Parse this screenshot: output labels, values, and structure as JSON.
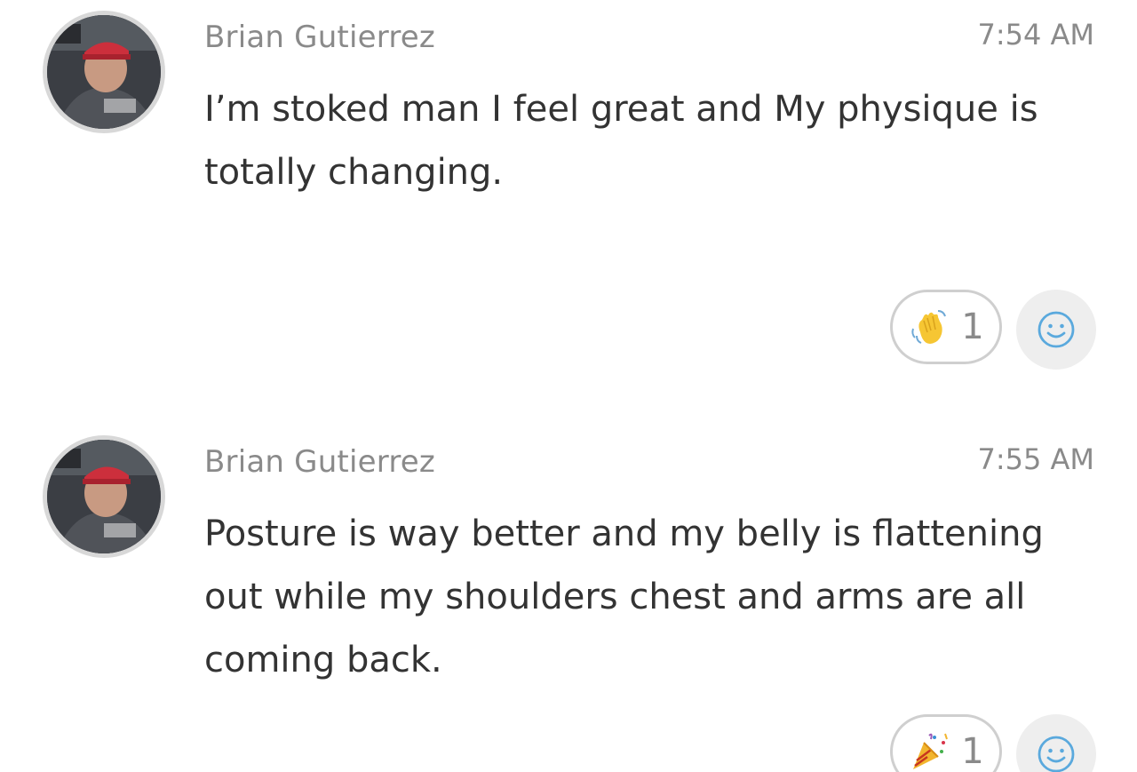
{
  "messages": [
    {
      "author": "Brian Gutierrez",
      "time": "7:54 AM",
      "text": "I’m stoked man I feel great and My physique is totally changing.",
      "reaction": {
        "emoji": "waving-hand",
        "count": "1"
      }
    },
    {
      "author": "Brian Gutierrez",
      "time": "7:55 AM",
      "text": "Posture is way better and my belly is flattening out while my shoulders chest and arms are all coming back.",
      "reaction": {
        "emoji": "party-popper",
        "count": "1"
      }
    }
  ],
  "colors": {
    "meta_text": "#8a8a8a",
    "body_text": "#333333",
    "smiley_blue": "#5aa9dd"
  }
}
